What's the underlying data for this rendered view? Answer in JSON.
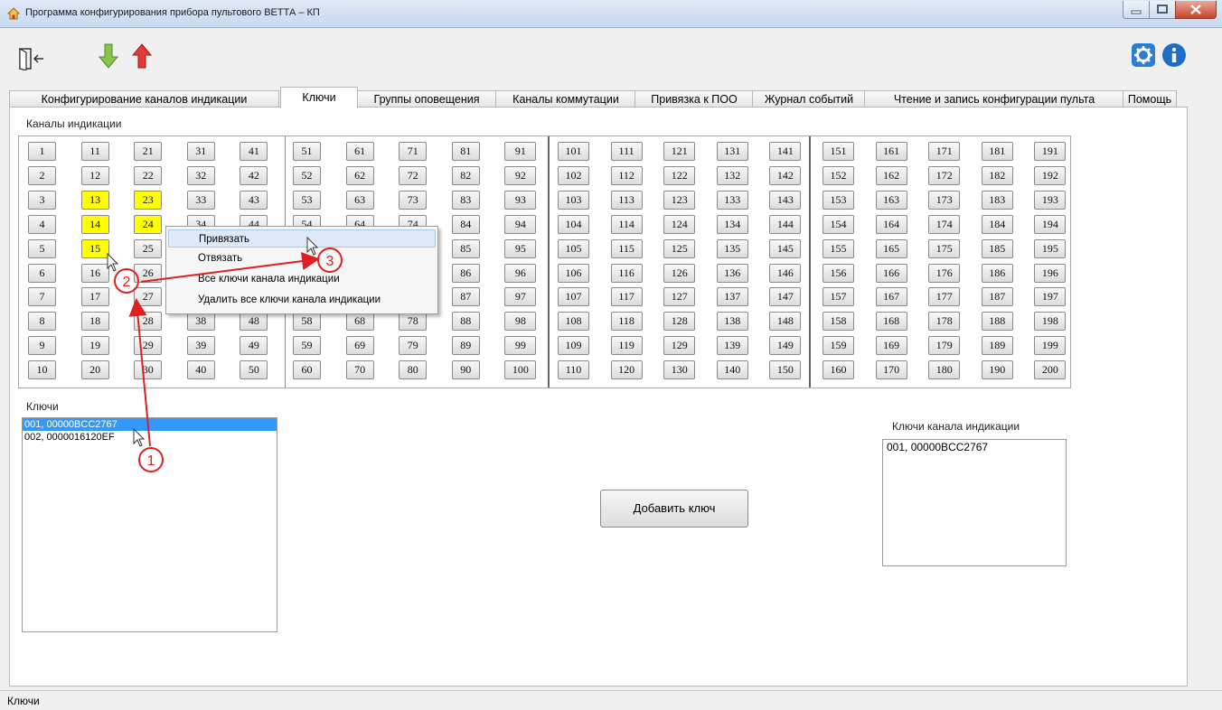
{
  "window": {
    "title": "Программа конфигурирования прибора пультового ВЕТТА – КП"
  },
  "colors": {
    "highlight_yellow": "#ffff00",
    "selection_blue": "#3399ff",
    "annotation_red": "#e02020"
  },
  "toolbar": {
    "icons": [
      "exit-door-icon",
      "download-arrow-icon",
      "upload-arrow-icon",
      "gear-icon",
      "info-icon"
    ]
  },
  "tabs": [
    "Конфигурирование каналов индикации",
    "Ключи",
    "Группы оповещения",
    "Каналы коммутации",
    "Привязка к ПОО",
    "Журнал событий",
    "Чтение и запись конфигурации пульта",
    "Помощь"
  ],
  "active_tab": "Ключи",
  "channels": {
    "label": "Каналы индикации",
    "count": 200,
    "highlighted": [
      13,
      14,
      15,
      23,
      24
    ]
  },
  "keys": {
    "label": "Ключи",
    "items": [
      "001, 00000BCC2767",
      "002, 0000016120EF"
    ],
    "selected_index": 0
  },
  "channel_keys": {
    "label": "Ключи канала индикации",
    "items": [
      "001, 00000BCC2767"
    ]
  },
  "add_key_button": "Добавить ключ",
  "context_menu": {
    "items": [
      "Привязать",
      "Отвязать",
      "Все ключи канала индикации",
      "Удалить все ключи канала индикации"
    ],
    "highlighted_index": 0
  },
  "annotations": [
    "1",
    "2",
    "3"
  ],
  "status": {
    "text": "Ключи"
  }
}
